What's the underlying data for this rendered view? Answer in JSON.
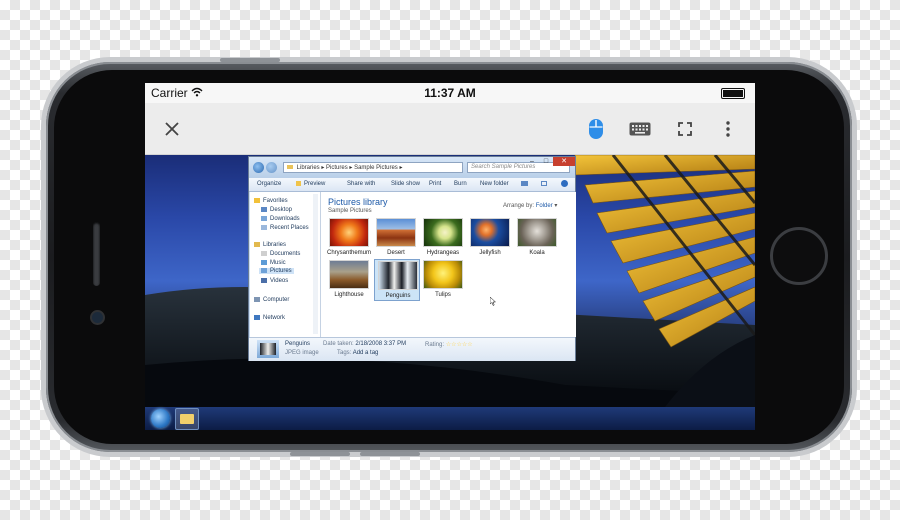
{
  "status_bar": {
    "carrier": "Carrier",
    "time": "11:37 AM"
  },
  "remote_toolbar": {
    "icons": [
      "close-icon",
      "mouse-icon",
      "keyboard-icon",
      "fullscreen-icon",
      "more-vertical-icon"
    ],
    "accent_color": "#2f8ee8"
  },
  "explorer": {
    "address_segments": [
      "Libraries",
      "Pictures",
      "Sample Pictures"
    ],
    "search_placeholder": "Search Sample Pictures",
    "commands": [
      "Organize",
      "Preview",
      "Share with",
      "Slide show",
      "Print",
      "Burn",
      "New folder"
    ],
    "nav": {
      "favorites": "Favorites",
      "favorite_items": [
        "Desktop",
        "Downloads",
        "Recent Places"
      ],
      "libraries": "Libraries",
      "library_items": [
        "Documents",
        "Music",
        "Pictures",
        "Videos"
      ],
      "computer": "Computer",
      "network": "Network"
    },
    "library_title": "Pictures library",
    "library_subtitle": "Sample Pictures",
    "arrange_label": "Arrange by:",
    "arrange_value": "Folder",
    "thumbnails": [
      "Chrysanthemum",
      "Desert",
      "Hydrangeas",
      "Jellyfish",
      "Koala",
      "Lighthouse",
      "Penguins",
      "Tulips"
    ],
    "selected": "Penguins",
    "details": {
      "name": "Penguins",
      "type": "JPEG image",
      "date_label": "Date taken:",
      "date_value": "2/18/2008 3:37 PM",
      "tags_label": "Tags:",
      "tags_value": "Add a tag",
      "rating_label": "Rating:",
      "rating_stars": "☆☆☆☆☆"
    }
  }
}
